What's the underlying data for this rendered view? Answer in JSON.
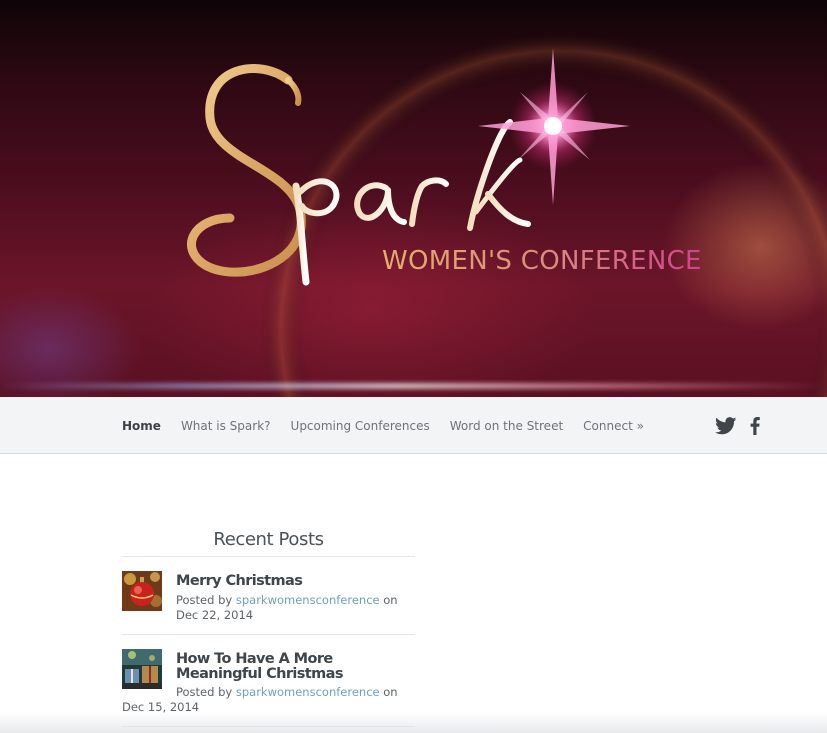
{
  "hero": {
    "logo_word": "Spark",
    "subtitle": "WOMEN'S CONFERENCE"
  },
  "nav": {
    "items": [
      {
        "label": "Home",
        "active": true
      },
      {
        "label": "What is Spark?",
        "active": false
      },
      {
        "label": "Upcoming Conferences",
        "active": false
      },
      {
        "label": "Word on the Street",
        "active": false
      },
      {
        "label": "Connect »",
        "active": false
      }
    ],
    "social": [
      {
        "icon": "twitter-icon"
      },
      {
        "icon": "facebook-icon"
      }
    ]
  },
  "recent_posts": {
    "title": "Recent Posts",
    "posts": [
      {
        "title": "Merry Christmas",
        "posted_by_prefix": "Posted by ",
        "author": "sparkwomensconference",
        "date_prefix": " on ",
        "date": "Dec 22, 2014",
        "thumbnail": "christmas-ornament"
      },
      {
        "title": "How To Have A More Meaningful Christmas",
        "posted_by_prefix": "Posted by ",
        "author": "sparkwomensconference",
        "date_prefix": " on ",
        "date": "Dec 15, 2014",
        "thumbnail": "christmas-gifts"
      }
    ]
  },
  "colors": {
    "hero_dark": "#2a0811",
    "hero_mid": "#6c1529",
    "logo_gold": "#e2b06a",
    "logo_pink": "#d2418e",
    "nav_bg": "#f3f4f5",
    "link": "#6f9fbd",
    "heading": "#3e454b"
  }
}
